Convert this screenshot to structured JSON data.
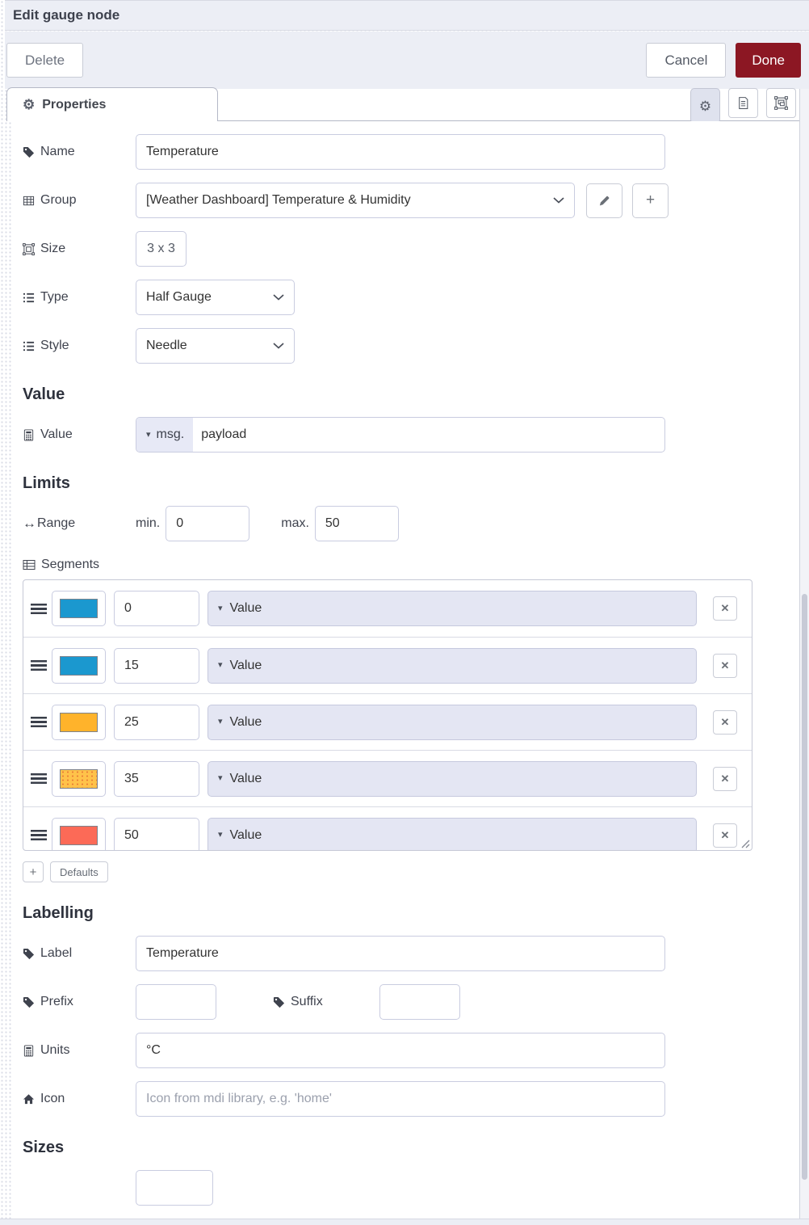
{
  "header": {
    "title": "Edit gauge node"
  },
  "toolbar": {
    "delete_label": "Delete",
    "cancel_label": "Cancel",
    "done_label": "Done"
  },
  "tabs": {
    "properties_label": "Properties"
  },
  "icons": {
    "gear": "⚙",
    "caret_down": "▾",
    "close": "✕",
    "plus": "+",
    "arrows_h": "↔"
  },
  "fields": {
    "name": {
      "label": "Name",
      "value": "Temperature"
    },
    "group": {
      "label": "Group",
      "value": "[Weather Dashboard] Temperature & Humidity"
    },
    "size": {
      "label": "Size",
      "value": "3 x 3"
    },
    "type": {
      "label": "Type",
      "value": "Half Gauge"
    },
    "style": {
      "label": "Style",
      "value": "Needle"
    }
  },
  "value_section": {
    "heading": "Value",
    "label": "Value",
    "prefix_token": "msg.",
    "value": "payload"
  },
  "limits_section": {
    "heading": "Limits",
    "range_label": "Range",
    "min_label": "min.",
    "min_value": "0",
    "max_label": "max.",
    "max_value": "50"
  },
  "segments_section": {
    "label": "Segments",
    "value_option_label": "Value",
    "rows": [
      {
        "color": "#1b98cf",
        "value": "0"
      },
      {
        "color": "#1b98cf",
        "value": "15"
      },
      {
        "color": "#ffb32b",
        "value": "25"
      },
      {
        "color": "#ffc24a",
        "value": "35",
        "pattern": "dotted"
      },
      {
        "color": "#fc6a57",
        "value": "50"
      }
    ],
    "defaults_label": "Defaults"
  },
  "labelling_section": {
    "heading": "Labelling",
    "label": {
      "label": "Label",
      "value": "Temperature"
    },
    "prefix": {
      "label": "Prefix",
      "value": ""
    },
    "suffix": {
      "label": "Suffix",
      "value": ""
    },
    "units": {
      "label": "Units",
      "value": "°C"
    },
    "icon": {
      "label": "Icon",
      "value": "",
      "placeholder": "Icon from mdi library, e.g. 'home'"
    }
  },
  "sizes_section": {
    "heading": "Sizes"
  },
  "colors": {
    "done_button": "#8c1723",
    "chrome_bg": "#eceef5",
    "token_bg": "#e7e9f6",
    "dropdown_bg": "#e4e6f3"
  }
}
